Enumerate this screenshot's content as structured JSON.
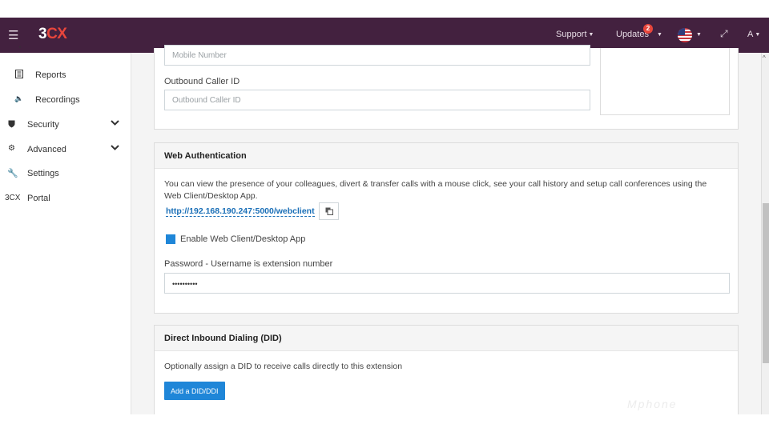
{
  "topbar": {
    "logo_prefix": "3",
    "logo_accent": "CX",
    "support_label": "Support",
    "updates_label": "Updates",
    "updates_badge": "2",
    "user_label": "A"
  },
  "sidebar": {
    "items": [
      {
        "label": "Reports",
        "icon": "list-icon"
      },
      {
        "label": "Recordings",
        "icon": "speaker-icon"
      },
      {
        "label": "Security",
        "icon": "shield-icon"
      },
      {
        "label": "Advanced",
        "icon": "gear-icon"
      },
      {
        "label": "Settings",
        "icon": "wrench-icon"
      },
      {
        "label": "Portal",
        "icon": "3cx-icon",
        "icon_text": "3CX"
      }
    ]
  },
  "phone_section": {
    "mobile_placeholder": "Mobile Number",
    "outbound_label": "Outbound Caller ID",
    "outbound_placeholder": "Outbound Caller ID"
  },
  "web_auth": {
    "title": "Web Authentication",
    "description": "You can view the presence of your colleagues, divert & transfer calls with a mouse click, see your call history and setup call conferences using the Web Client/Desktop App.",
    "url": "http://192.168.190.247:5000/webclient",
    "enable_label": "Enable Web Client/Desktop App",
    "enable_checked": true,
    "password_label": "Password - Username is extension number",
    "password_value": "••••••••••"
  },
  "did": {
    "title": "Direct Inbound Dialing (DID)",
    "description": "Optionally assign a DID to receive calls directly to this extension",
    "add_button": "Add a DID/DDI"
  },
  "watermark": "Mphone",
  "colors": {
    "topbar_bg": "#43213f",
    "accent_blue": "#1f86d8",
    "link_blue": "#1a6fb7",
    "logo_red": "#e8463c"
  }
}
